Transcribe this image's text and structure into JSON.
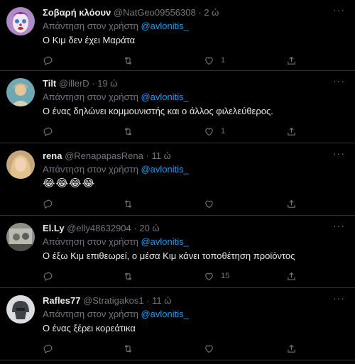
{
  "tweets": [
    {
      "name": "Σοβαρή κλόουν",
      "handle": "@NatGeo09556308",
      "dot": "·",
      "time": "2 ώ",
      "reply_prefix": "Απάντηση στον χρήστη",
      "reply_user": "@avlonitis_",
      "text": "Ο Κιμ δεν έχει Μαράτα",
      "like_count": "1",
      "avatar_kind": "clown"
    },
    {
      "name": "Tilt",
      "handle": "@illerD",
      "dot": "·",
      "time": "19 ώ",
      "reply_prefix": "Απάντηση στον χρήστη",
      "reply_user": "@avlonitis_",
      "text": "Ο ένας δηλώνει κομμουνιστής και ο άλλος φιλελεύθερος.",
      "like_count": "1",
      "avatar_kind": "person"
    },
    {
      "name": "rena",
      "handle": "@RenapapasRena",
      "dot": "·",
      "time": "11 ώ",
      "reply_prefix": "Απάντηση στον χρήστη",
      "reply_user": "@avlonitis_",
      "text": "😂😂😂😂",
      "like_count": "",
      "avatar_kind": "blonde"
    },
    {
      "name": "El.Ly",
      "handle": "@elly48632904",
      "dot": "·",
      "time": "20 ώ",
      "reply_prefix": "Απάντηση στον χρήστη",
      "reply_user": "@avlonitis_",
      "text": "Ο έξω Κιμ επιθεωρεί, ο μέσα Κιμ κάνει τοποθέτηση προϊόντος",
      "like_count": "15",
      "avatar_kind": "photo"
    },
    {
      "name": "Rafles77",
      "handle": "@Stratigakos1",
      "dot": "·",
      "time": "11 ώ",
      "reply_prefix": "Απάντηση στον χρήστη",
      "reply_user": "@avlonitis_",
      "text": "Ο ένας ξέρει κορεάτικα",
      "like_count": "",
      "avatar_kind": "helmet"
    }
  ],
  "icons": {
    "more": "more-icon",
    "reply": "reply-icon",
    "retweet": "retweet-icon",
    "like": "like-icon",
    "share": "share-icon"
  },
  "colors": {
    "background": "#000000",
    "text": "#e7e9ea",
    "muted": "#71767b",
    "link": "#1d9bf0",
    "divider": "#2f3336"
  },
  "more_glyph": "···"
}
